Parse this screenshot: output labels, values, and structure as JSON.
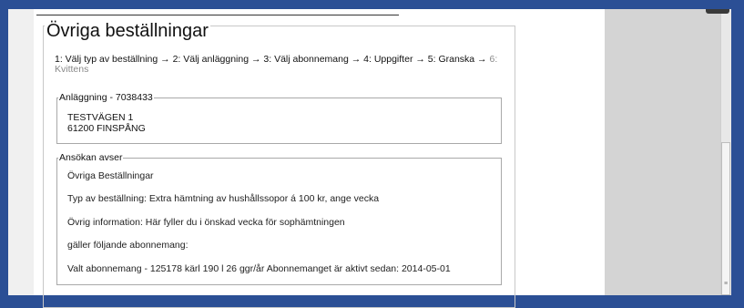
{
  "page": {
    "title": "Övriga beställningar"
  },
  "steps": [
    {
      "label": "1: Välj typ av beställning →",
      "state": "done"
    },
    {
      "label": "2: Välj anläggning →",
      "state": "done"
    },
    {
      "label": "3: Välj abonnemang →",
      "state": "done"
    },
    {
      "label": "4: Uppgifter →",
      "state": "done"
    },
    {
      "label": "5: Granska →",
      "state": "current"
    },
    {
      "label": "6: Kvittens",
      "state": "pending"
    }
  ],
  "anlaggning": {
    "legend": "Anläggning - 7038433",
    "street": "TESTVÄGEN 1",
    "city": "61200 FINSPÅNG"
  },
  "ansokan": {
    "legend": "Ansökan avser",
    "lines": [
      "Övriga Beställningar",
      "Typ av beställning: Extra hämtning av hushållssopor á 100 kr, ange vecka",
      "Övrig information: Här fyller du i önskad vecka för sophämtningen",
      "gäller följande abonnemang:",
      "Valt abonnemang - 125178 kärl 190 l 26 ggr/år Abonnemanget är aktivt sedan: 2014-05-01"
    ]
  },
  "scrollbar": {
    "grip_glyph": "≡"
  },
  "colors": {
    "frame": "#2b4f95",
    "content_bg": "#ffffff",
    "side_pane": "#d4d4d4",
    "border": "#a9a9a9",
    "pending_step": "#888888"
  }
}
